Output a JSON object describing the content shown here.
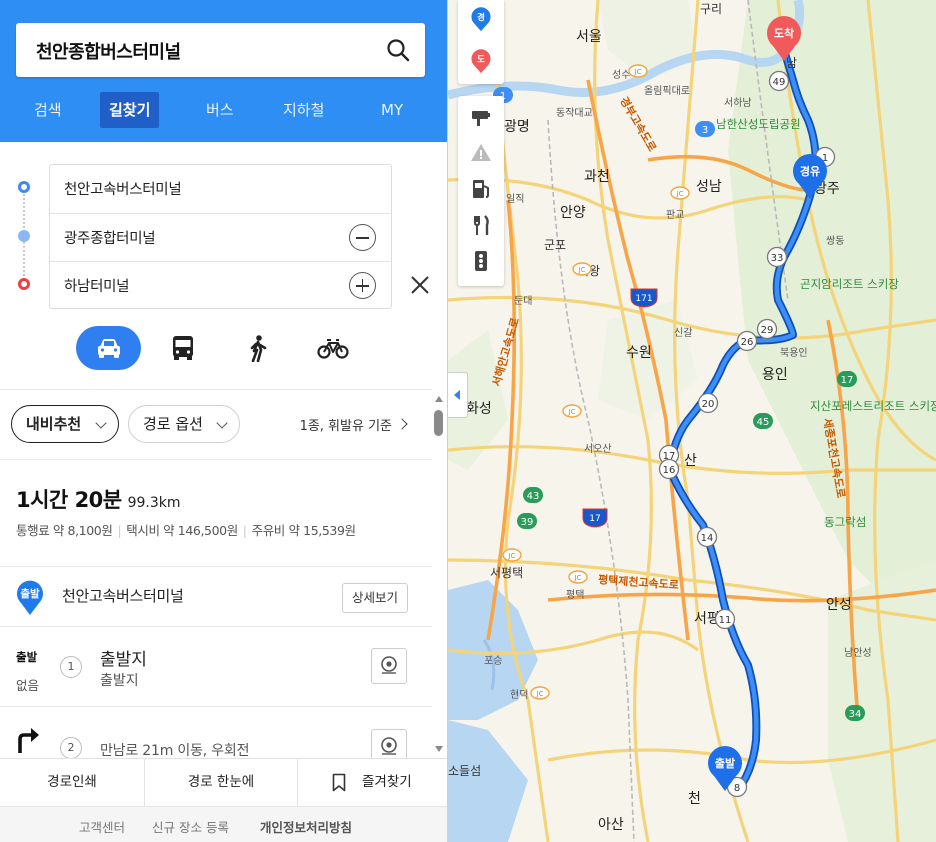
{
  "search": {
    "query": "천안종합버스터미널"
  },
  "tabs": [
    "검색",
    "길찾기",
    "버스",
    "지하철",
    "MY"
  ],
  "active_tab": "길찾기",
  "waypoints": {
    "start": "천안고속버스터미널",
    "via": "광주종합터미널",
    "end": "하남터미널"
  },
  "modes": [
    "car",
    "bus",
    "walk",
    "bike"
  ],
  "active_mode": "car",
  "options": {
    "recommend": "내비추천",
    "route_options": "경로 옵션",
    "fuel_basis": "1종, 휘발유 기준"
  },
  "summary": {
    "time": "1시간 20분",
    "distance": "99.3km",
    "toll": "통행료 약 8,100원",
    "taxi": "택시비 약 146,500원",
    "fuel": "주유비 약 15,539원"
  },
  "origin": {
    "badge": "출발",
    "name": "천안고속버스터미널",
    "detail_button": "상세보기"
  },
  "steps": [
    {
      "num": "1",
      "badge": "출발",
      "sub_left": "없음",
      "title": "출발지",
      "subtitle": "출발지"
    },
    {
      "num": "2",
      "desc": "만남로 21m 이동, 우회전"
    }
  ],
  "bottom_actions": [
    "경로인쇄",
    "경로 한눈에",
    "즐겨찾기"
  ],
  "footer": [
    "고객센터",
    "신규 장소 등록",
    "개인정보처리방침"
  ],
  "map": {
    "tool_badges": [
      "경",
      "도"
    ],
    "markers": {
      "arrival": "도착",
      "via": "경유",
      "departure": "출발"
    },
    "highway_numbers": [
      "1",
      "3",
      "43",
      "39",
      "45",
      "17",
      "34",
      "171"
    ],
    "route_exits": [
      "49",
      "1",
      "33",
      "29",
      "26",
      "20",
      "17",
      "16",
      "14",
      "11",
      "8"
    ],
    "places": [
      "구리",
      "서울",
      "남",
      "성수",
      "올림픽대로",
      "서하남",
      "동작대교",
      "남한산성도립공원",
      "광명",
      "과천",
      "성남",
      "광주",
      "일직",
      "판교",
      "안양",
      "쌍동",
      "군포",
      "의왕",
      "곤지암리조트 스키장",
      "둔대",
      "신갈",
      "북용인",
      "수원",
      "용인",
      "화성",
      "서오산",
      "지산포레스트리조트 스키장",
      "산",
      "동그락섬",
      "서평택",
      "평택",
      "안성",
      "포승",
      "현덕",
      "남안성",
      "소들섬",
      "천",
      "아산",
      "경부고속도로",
      "서해안고속도로",
      "평택제천고속도로",
      "세종포천고속도로",
      "JC"
    ],
    "colors": {
      "route": "#1f6fe8",
      "route_outline": "#0f4fb8",
      "arrival_pin": "#f15a5a",
      "via_pin": "#1f6fe8"
    }
  }
}
